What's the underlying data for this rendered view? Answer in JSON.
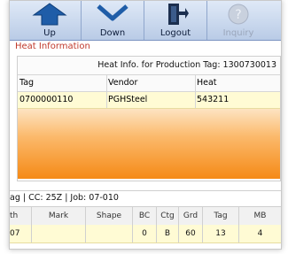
{
  "toolbar": {
    "buttons": [
      {
        "label": "Up",
        "icon": "up-arrow-icon"
      },
      {
        "label": "Down",
        "icon": "down-arrow-icon"
      },
      {
        "label": "Logout",
        "icon": "logout-door-icon"
      },
      {
        "label": "Inquiry",
        "icon": "help-icon"
      }
    ]
  },
  "heat_section": {
    "title": "Heat Information",
    "header": "Heat Info. for Production Tag: 1300730013",
    "columns": [
      "Tag",
      "Vendor",
      "Heat"
    ],
    "rows": [
      {
        "tag": "0700000110",
        "vendor": "PGHSteel",
        "heat": "543211"
      }
    ]
  },
  "job_bar": {
    "text": "ag | CC: 25Z  | Job: 07-010"
  },
  "table": {
    "columns": [
      "th",
      "Mark",
      "Shape",
      "BC",
      "Ctg",
      "Grd",
      "Tag",
      "MB"
    ],
    "rows": [
      [
        "07",
        "",
        "",
        "0",
        "B",
        "60",
        "13",
        "4"
      ]
    ]
  },
  "colors": {
    "section_title": "#c0392b",
    "row_highlight": "#fffbd4",
    "orange": "#f58a16",
    "toolbar": "#b9cbe6"
  }
}
